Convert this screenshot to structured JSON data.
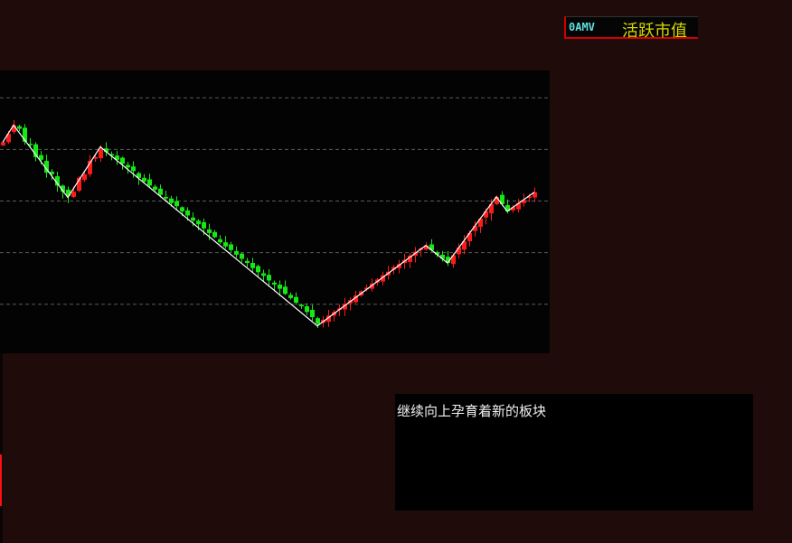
{
  "legend": {
    "code": "0AMV",
    "name": "活跃市值"
  },
  "note": {
    "text": "继续向上孕育着新的板块"
  },
  "colors": {
    "up": "#ff1a1a",
    "down": "#16e816",
    "zigzag": "#ffffff",
    "grid": "#5a5a5a"
  },
  "chart_data": {
    "type": "candlestick",
    "title": "",
    "xlabel": "",
    "ylabel": "",
    "ylim": [
      5,
      553
    ],
    "gridlines": [
      100,
      200,
      300,
      400,
      500
    ],
    "close": [
      414,
      430,
      447,
      440,
      415,
      410,
      385,
      380,
      355,
      352,
      330,
      318,
      310,
      318,
      345,
      352,
      378,
      385,
      400,
      395,
      388,
      380,
      372,
      365,
      358,
      345,
      338,
      330,
      322,
      312,
      305,
      296,
      290,
      280,
      272,
      262,
      255,
      247,
      238,
      230,
      220,
      212,
      205,
      196,
      188,
      180,
      170,
      162,
      155,
      146,
      138,
      130,
      120,
      112,
      103,
      96,
      85,
      75,
      62,
      70,
      78,
      85,
      92,
      100,
      108,
      117,
      125,
      132,
      140,
      148,
      156,
      163,
      172,
      178,
      186,
      194,
      202,
      208,
      214,
      205,
      196,
      188,
      180,
      195,
      210,
      222,
      238,
      252,
      266,
      280,
      294,
      308,
      294,
      280,
      288,
      296,
      302,
      309,
      317
    ],
    "zigzag": [
      [
        0,
        414
      ],
      [
        2,
        447
      ],
      [
        12,
        307
      ],
      [
        18,
        405
      ],
      [
        58,
        58
      ],
      [
        78,
        214
      ],
      [
        82,
        180
      ],
      [
        91,
        308
      ],
      [
        93,
        280
      ],
      [
        98,
        317
      ]
    ]
  }
}
